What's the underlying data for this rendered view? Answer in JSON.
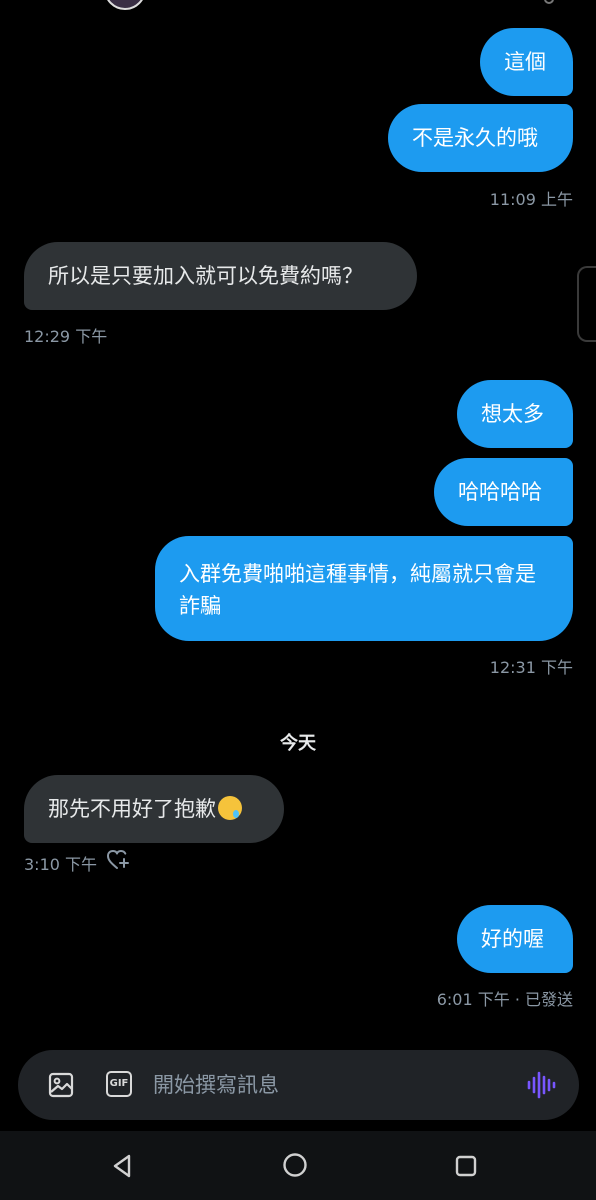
{
  "messages": [
    {
      "text": "這個"
    },
    {
      "text": "不是永久的哦"
    },
    {
      "text": "所以是只要加入就可以免費約嗎？"
    },
    {
      "text": "想太多"
    },
    {
      "text": "哈哈哈哈"
    },
    {
      "text": "入群免費啪啪這種事情，純屬就只會是詐騙"
    },
    {
      "text": "那先不用好了抱歉"
    },
    {
      "text": "好的喔"
    }
  ],
  "timestamps": {
    "t1": "11:09 上午",
    "t2": "12:29 下午",
    "t3": "12:31 下午",
    "t5": "3:10 下午",
    "t6": "6:01 下午 · 已發送"
  },
  "day_divider": "今天",
  "composer": {
    "placeholder": "開始撰寫訊息",
    "gif_label": "GIF"
  },
  "icons": {
    "emoji": "smiling-face-with-tear",
    "react": "heart-plus-icon",
    "media": "image-icon",
    "voice": "voice-wave-icon",
    "voice_color": "#7856ff",
    "accent": "#1d9bf0"
  }
}
